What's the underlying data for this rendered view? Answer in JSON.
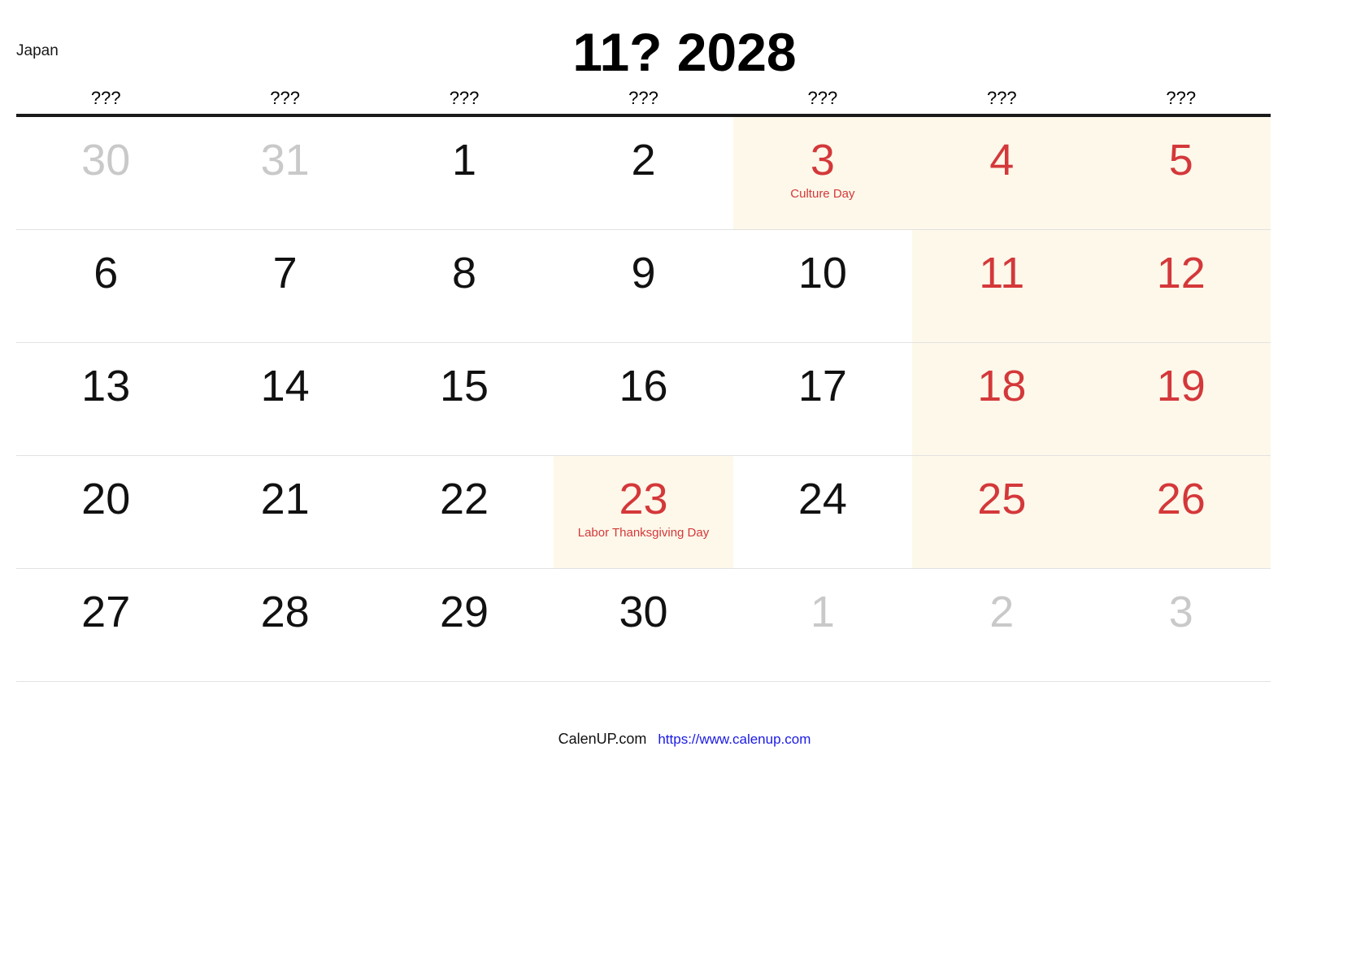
{
  "header": {
    "region": "Japan",
    "title": "11? 2028"
  },
  "weekdays": [
    "???",
    "???",
    "???",
    "???",
    "???",
    "???",
    "???"
  ],
  "weeks": [
    [
      {
        "num": "30",
        "style": "other-month",
        "highlight": false,
        "event": ""
      },
      {
        "num": "31",
        "style": "other-month",
        "highlight": false,
        "event": ""
      },
      {
        "num": "1",
        "style": "normal",
        "highlight": false,
        "event": ""
      },
      {
        "num": "2",
        "style": "normal",
        "highlight": false,
        "event": ""
      },
      {
        "num": "3",
        "style": "weekend",
        "highlight": true,
        "event": "Culture Day"
      },
      {
        "num": "4",
        "style": "weekend",
        "highlight": true,
        "event": ""
      },
      {
        "num": "5",
        "style": "weekend",
        "highlight": true,
        "event": ""
      }
    ],
    [
      {
        "num": "6",
        "style": "normal",
        "highlight": false,
        "event": ""
      },
      {
        "num": "7",
        "style": "normal",
        "highlight": false,
        "event": ""
      },
      {
        "num": "8",
        "style": "normal",
        "highlight": false,
        "event": ""
      },
      {
        "num": "9",
        "style": "normal",
        "highlight": false,
        "event": ""
      },
      {
        "num": "10",
        "style": "normal",
        "highlight": false,
        "event": ""
      },
      {
        "num": "11",
        "style": "weekend",
        "highlight": true,
        "event": ""
      },
      {
        "num": "12",
        "style": "weekend",
        "highlight": true,
        "event": ""
      }
    ],
    [
      {
        "num": "13",
        "style": "normal",
        "highlight": false,
        "event": ""
      },
      {
        "num": "14",
        "style": "normal",
        "highlight": false,
        "event": ""
      },
      {
        "num": "15",
        "style": "normal",
        "highlight": false,
        "event": ""
      },
      {
        "num": "16",
        "style": "normal",
        "highlight": false,
        "event": ""
      },
      {
        "num": "17",
        "style": "normal",
        "highlight": false,
        "event": ""
      },
      {
        "num": "18",
        "style": "weekend",
        "highlight": true,
        "event": ""
      },
      {
        "num": "19",
        "style": "weekend",
        "highlight": true,
        "event": ""
      }
    ],
    [
      {
        "num": "20",
        "style": "normal",
        "highlight": false,
        "event": ""
      },
      {
        "num": "21",
        "style": "normal",
        "highlight": false,
        "event": ""
      },
      {
        "num": "22",
        "style": "normal",
        "highlight": false,
        "event": ""
      },
      {
        "num": "23",
        "style": "weekend",
        "highlight": true,
        "event": "Labor Thanksgiving Day"
      },
      {
        "num": "24",
        "style": "normal",
        "highlight": false,
        "event": ""
      },
      {
        "num": "25",
        "style": "weekend",
        "highlight": true,
        "event": ""
      },
      {
        "num": "26",
        "style": "weekend",
        "highlight": true,
        "event": ""
      }
    ],
    [
      {
        "num": "27",
        "style": "normal",
        "highlight": false,
        "event": ""
      },
      {
        "num": "28",
        "style": "normal",
        "highlight": false,
        "event": ""
      },
      {
        "num": "29",
        "style": "normal",
        "highlight": false,
        "event": ""
      },
      {
        "num": "30",
        "style": "normal",
        "highlight": false,
        "event": ""
      },
      {
        "num": "1",
        "style": "other-month",
        "highlight": false,
        "event": ""
      },
      {
        "num": "2",
        "style": "other-month",
        "highlight": false,
        "event": ""
      },
      {
        "num": "3",
        "style": "other-month",
        "highlight": false,
        "event": ""
      }
    ]
  ],
  "footer": {
    "brand": "CalenUP.com",
    "url": "https://www.calenup.com"
  },
  "colors": {
    "holiday_text": "#d4383a",
    "holiday_bg": "#fdf8ea",
    "other_month_text": "#c9c9c9",
    "link": "#1a1ae6",
    "header_rule": "#1a1a1a",
    "row_rule": "#e2e2e2"
  }
}
